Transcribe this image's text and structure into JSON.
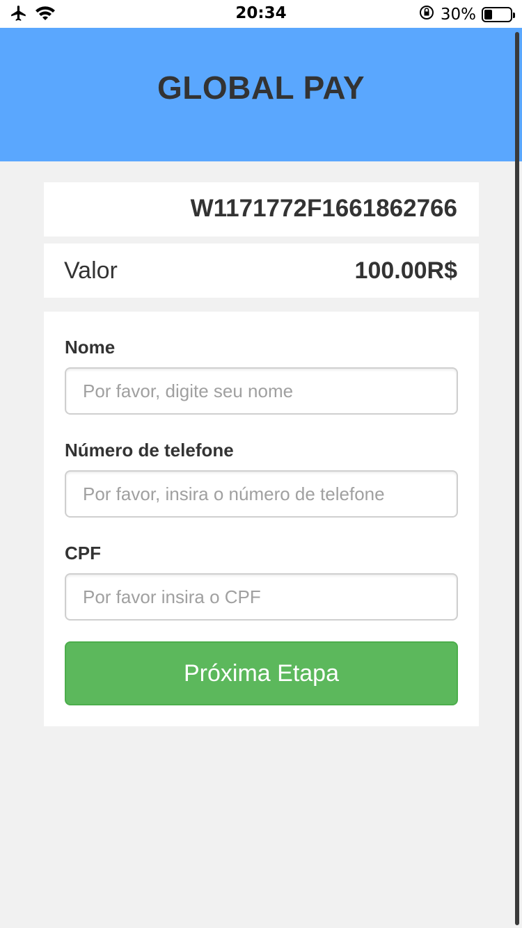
{
  "status_bar": {
    "time": "20:34",
    "battery_percent": "30%",
    "battery_level": 0.3,
    "icons": [
      "airplane-icon",
      "wifi-icon",
      "rotation-lock-icon",
      "battery-icon"
    ]
  },
  "header": {
    "title": "GLOBAL PAY",
    "background_color": "#5aa7fe"
  },
  "order": {
    "id": "W1171772F1661862766"
  },
  "amount": {
    "label": "Valor",
    "value": "100.00R$"
  },
  "form": {
    "name_label": "Nome",
    "name_placeholder": "Por favor, digite seu nome",
    "phone_label": "Número de telefone",
    "phone_placeholder": "Por favor, insira o número de telefone",
    "cpf_label": "CPF",
    "cpf_placeholder": "Por favor insira o CPF",
    "submit_label": "Próxima Etapa",
    "submit_color": "#5cb85c"
  }
}
